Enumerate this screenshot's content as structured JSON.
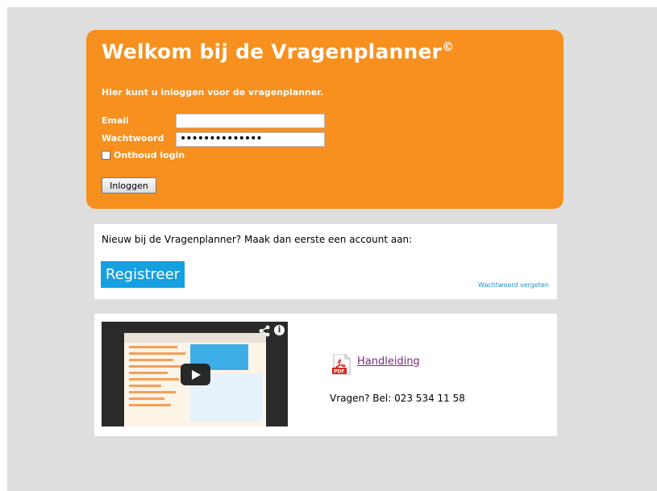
{
  "login": {
    "title": "Welkom bij de Vragenplanner",
    "title_mark": "©",
    "subtitle": "Hier kunt u inloggen voor de vragenplanner.",
    "email_label": "Email",
    "email_value": "",
    "password_label": "Wachtwoord",
    "password_value": "••••••••••••••",
    "remember_label": "Onthoud login",
    "submit_label": "Inloggen"
  },
  "register": {
    "prompt": "Nieuw bij de Vragenplanner? Maak dan eerste een account aan:",
    "button_label": "Registreer",
    "forgot_link": "Wachtwoord vergeten"
  },
  "help": {
    "manual_link": "Handleiding",
    "contact_text": "Vragen? Bel: 023 534 11 58"
  },
  "colors": {
    "panel_orange": "#f7901e",
    "register_blue": "#16a0e0",
    "link_blue": "#1a8fd6",
    "manual_purple": "#7a2a7c"
  },
  "icons": [
    "share-icon",
    "info-icon",
    "play-icon",
    "pdf-icon"
  ]
}
